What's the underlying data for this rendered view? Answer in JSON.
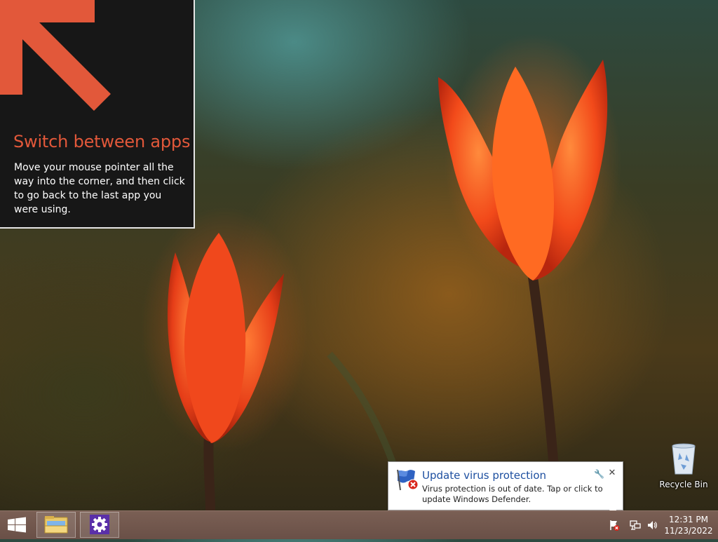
{
  "tip": {
    "title": "Switch between apps",
    "body": "Move your mouse pointer all the way into the corner, and then click to go back to the last app you were using."
  },
  "desktop": {
    "recycle_bin_label": "Recycle Bin"
  },
  "notification": {
    "title": "Update virus protection",
    "text": "Virus protection is out of date. Tap or click to update Windows Defender.",
    "icon": "windows-defender-warning-icon",
    "title_color": "#1d4fa0"
  },
  "taskbar": {
    "pinned": [
      {
        "name": "file-explorer",
        "icon": "folder-icon"
      },
      {
        "name": "pc-settings",
        "icon": "gear-icon"
      }
    ],
    "tray_icons": [
      "action-center-flag-icon",
      "network-icon",
      "volume-icon"
    ],
    "time": "12:31 PM",
    "date": "11/23/2022"
  },
  "colors": {
    "accent": "#e2583a",
    "taskbar": "#6e5349"
  }
}
